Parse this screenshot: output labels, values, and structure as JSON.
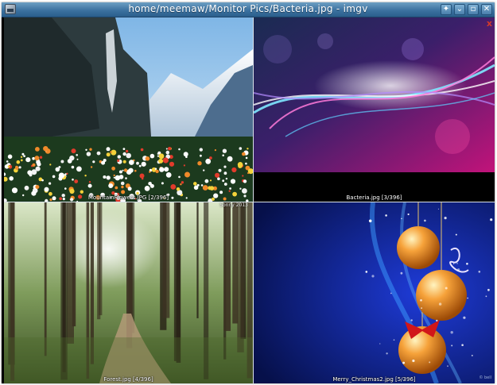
{
  "window": {
    "title": "home/meemaw/Monitor Pics/Bacteria.jpg - imgv",
    "controls": [
      {
        "name": "pin",
        "glyph": "✦"
      },
      {
        "name": "minimize",
        "glyph": "⌄"
      },
      {
        "name": "maximize",
        "glyph": "▫"
      },
      {
        "name": "close",
        "glyph": "✕"
      }
    ]
  },
  "tiles": [
    {
      "file": "MountainFlowers.jpg",
      "caption": "MountainFlowers.JPG [2/396]"
    },
    {
      "file": "Bacteria.jpg",
      "caption": "Bacteria.jpg [3/396]",
      "close_glyph": "x"
    },
    {
      "file": "Forest.jpg",
      "caption": "Forest.jpg [4/396]",
      "corner_text": "Sonny 2013"
    },
    {
      "file": "Merry_Christmas2.jpg",
      "caption": "Merry_Christmas2.jpg [5/396]",
      "watermark": "© bell"
    }
  ],
  "colors": {
    "titlebar": "#3c72a0",
    "background": "#000000"
  }
}
